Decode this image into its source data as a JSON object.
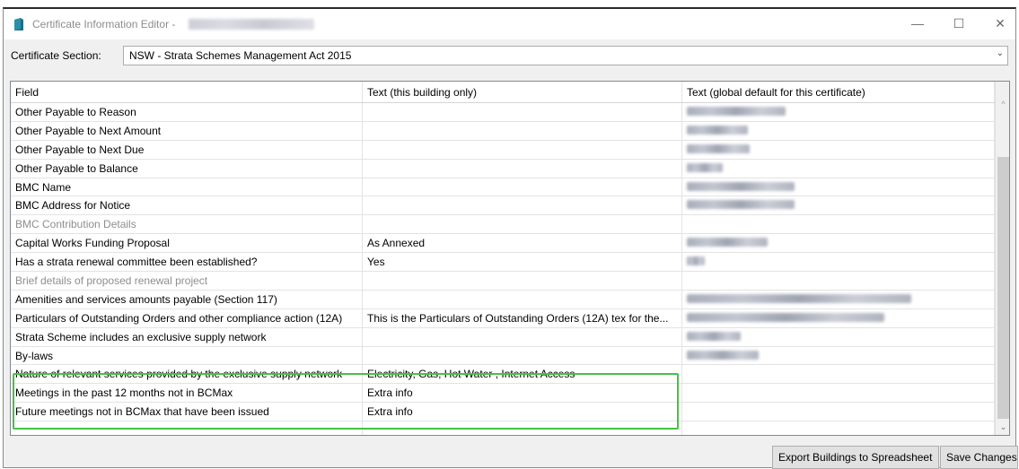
{
  "window": {
    "title": "Certificate Information Editor -",
    "minimize_glyph": "—",
    "maximize_glyph": "☐",
    "close_glyph": "✕"
  },
  "section": {
    "label": "Certificate Section:",
    "selected": "NSW - Strata Schemes Management Act 2015",
    "arrow": "⌄"
  },
  "grid": {
    "columns": [
      "Field",
      "Text (this building only)",
      "Text (global default for this certificate)"
    ],
    "rows": [
      {
        "field": "Other Payable to Reason",
        "building": "",
        "global_blur": 110,
        "disabled": false
      },
      {
        "field": "Other Payable to Next Amount",
        "building": "",
        "global_blur": 68,
        "disabled": false
      },
      {
        "field": "Other Payable to Next Due",
        "building": "",
        "global_blur": 70,
        "disabled": false
      },
      {
        "field": "Other Payable to Balance",
        "building": "",
        "global_blur": 40,
        "disabled": false
      },
      {
        "field": "BMC Name",
        "building": "",
        "global_blur": 120,
        "disabled": false
      },
      {
        "field": "BMC Address for Notice",
        "building": "",
        "global_blur": 120,
        "disabled": false
      },
      {
        "field": "BMC Contribution Details",
        "building": "",
        "global_blur": 0,
        "disabled": true
      },
      {
        "field": "Capital Works Funding Proposal",
        "building": "As Annexed",
        "global_blur": 90,
        "disabled": false
      },
      {
        "field": "Has a strata renewal committee been established?",
        "building": "Yes",
        "global_blur": 20,
        "disabled": false
      },
      {
        "field": "Brief details of proposed renewal project",
        "building": "",
        "global_blur": 0,
        "disabled": true
      },
      {
        "field": "Amenities and services amounts payable (Section 117)",
        "building": "",
        "global_blur": 250,
        "disabled": false
      },
      {
        "field": "Particulars of Outstanding Orders and other compliance action (12A)",
        "building": "This is the Particulars of Outstanding Orders (12A) tex for the...",
        "global_blur": 220,
        "disabled": false
      },
      {
        "field": "Strata Scheme includes an exclusive supply network",
        "building": "",
        "global_blur": 60,
        "disabled": false
      },
      {
        "field": "By-laws",
        "building": "",
        "global_blur": 80,
        "disabled": false
      },
      {
        "field": "Nature of relevant services provided by the exclusive supply network",
        "building": "Electricity, Gas, Hot Water , Internet Access",
        "global_blur": 0,
        "disabled": false
      },
      {
        "field": "Meetings in the past 12 months not in BCMax",
        "building": "Extra info",
        "global_blur": 0,
        "disabled": false
      },
      {
        "field": "Future meetings not in BCMax that have been issued",
        "building": "Extra info",
        "global_blur": 0,
        "disabled": false
      },
      {
        "field": "",
        "building": "",
        "global_blur": 0,
        "disabled": false
      }
    ],
    "scroll_up": "^",
    "scroll_down": "⌄"
  },
  "buttons": {
    "export": "Export Buildings to Spreadsheet",
    "save": "Save Changes"
  },
  "colors": {
    "highlight": "#47c047",
    "disabled_text": "#8e8e8e"
  }
}
